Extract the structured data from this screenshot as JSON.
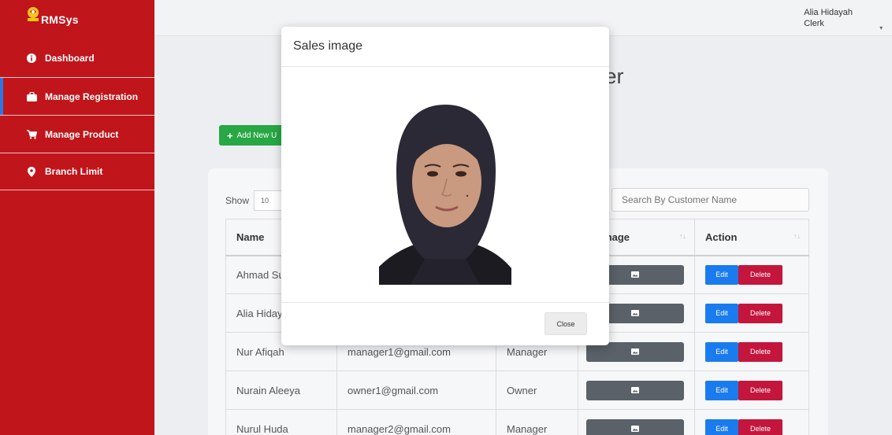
{
  "brand": {
    "name": "RMSys",
    "logo_text": "RMS"
  },
  "sidebar": {
    "items": [
      {
        "label": "Dashboard",
        "icon": "info-circle-icon"
      },
      {
        "label": "Manage Registration",
        "icon": "briefcase-icon",
        "active": true
      },
      {
        "label": "Manage Product",
        "icon": "cart-icon"
      },
      {
        "label": "Branch Limit",
        "icon": "map-marker-icon"
      }
    ]
  },
  "user": {
    "name": "Alia Hidayah",
    "role": "Clerk"
  },
  "page": {
    "title": "ser",
    "add_button": "Add New U"
  },
  "table": {
    "show_label": "Show",
    "show_value": "10",
    "search_placeholder": "Search By Customer Name",
    "headers": [
      "Name",
      "",
      "",
      "le Image",
      "Action"
    ],
    "rows": [
      {
        "name": "Ahmad Su",
        "email": "",
        "role": ""
      },
      {
        "name": "Alia Hiday",
        "email": "",
        "role": ""
      },
      {
        "name": "Nur Afiqah",
        "email": "manager1@gmail.com",
        "role": "Manager"
      },
      {
        "name": "Nurain Aleeya",
        "email": "owner1@gmail.com",
        "role": "Owner"
      },
      {
        "name": "Nurul Huda",
        "email": "manager2@gmail.com",
        "role": "Manager"
      }
    ],
    "edit_label": "Edit",
    "delete_label": "Delete"
  },
  "modal": {
    "title": "Sales image",
    "close_label": "Close"
  },
  "colors": {
    "sidebar": "#c0151b",
    "active_indicator": "#2b78e4",
    "add_button": "#28a745",
    "edit_button": "#1a7bef",
    "delete_button": "#c4163c",
    "image_button": "#5a6168"
  }
}
